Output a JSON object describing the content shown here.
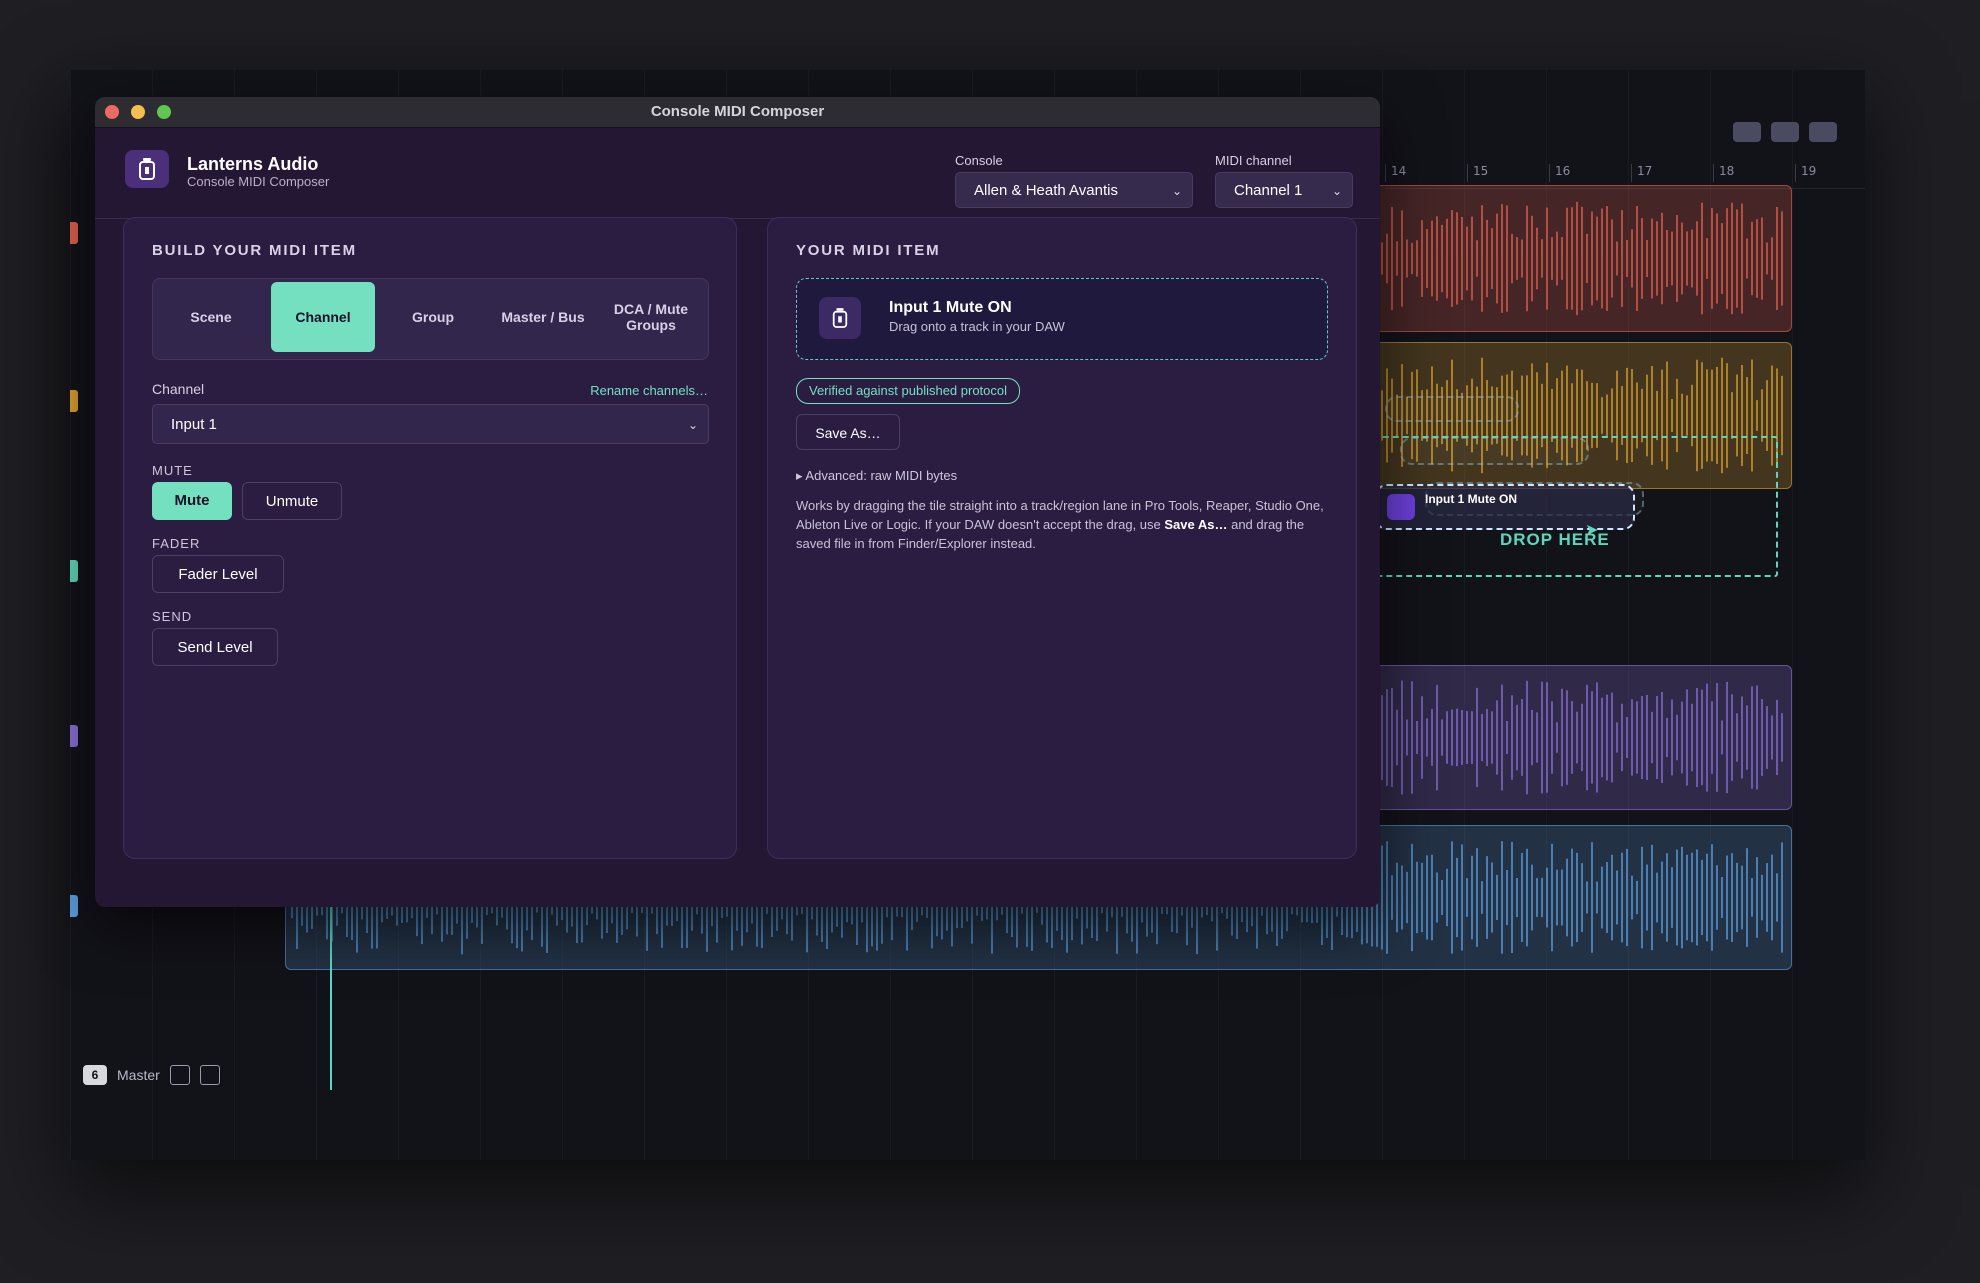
{
  "window": {
    "title": "Console MIDI Composer"
  },
  "header": {
    "brand": "Lanterns Audio",
    "subtitle": "Console MIDI Composer",
    "console_label": "Console",
    "console_value": "Allen & Heath Avantis",
    "midi_label": "MIDI channel",
    "midi_value": "Channel 1"
  },
  "builder": {
    "title": "BUILD YOUR MIDI ITEM",
    "tabs": [
      {
        "label": "Scene"
      },
      {
        "label": "Channel"
      },
      {
        "label": "Group"
      },
      {
        "label": "Master / Bus"
      },
      {
        "label": "DCA / Mute Groups"
      }
    ],
    "active_tab": "Channel",
    "channel_label": "Channel",
    "rename_link": "Rename channels…",
    "channel_value": "Input 1",
    "mute_section": "MUTE",
    "mute_btn": "Mute",
    "unmute_btn": "Unmute",
    "fader_section": "FADER",
    "fader_btn": "Fader Level",
    "send_section": "SEND",
    "send_btn": "Send Level"
  },
  "item": {
    "title": "YOUR MIDI ITEM",
    "tile_title": "Input 1 Mute ON",
    "tile_sub": "Drag onto a track in your DAW",
    "badge": "Verified against published protocol",
    "save_btn": "Save As…",
    "advanced": "▸ Advanced: raw MIDI bytes",
    "desc_1": "Works by dragging the tile straight into a track/region lane in Pro Tools, Reaper, Studio One, Ableton Live or Logic. If your DAW doesn't accept the drag, use ",
    "desc_bold": "Save As…",
    "desc_2": " and drag the saved file in from Finder/Explorer instead."
  },
  "daw": {
    "ruler": [
      "14",
      "15",
      "16",
      "17",
      "18",
      "19"
    ],
    "master_num": "6",
    "master_label": "Master",
    "drop_label": "DROP HERE",
    "ghost_title": "Input 1 Mute ON"
  },
  "colors": {
    "accent": "#74e0c0",
    "red": "#e0604e",
    "yellow": "#d9a02e",
    "purple": "#8a6fd6",
    "blue": "#5b9fe0"
  }
}
